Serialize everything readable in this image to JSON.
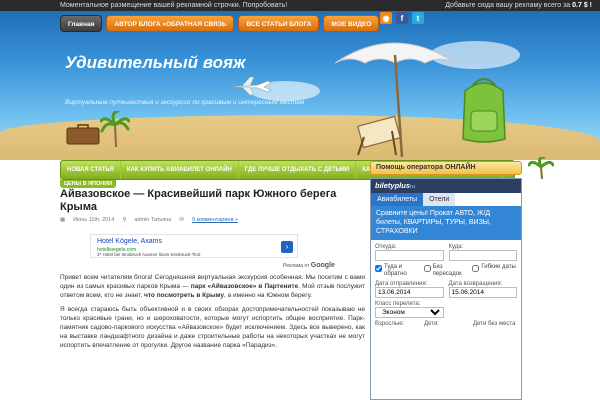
{
  "topbar": {
    "ticker": "Моментальное размещение вашей рекламной строчки. Попробовать!",
    "ad_text": "Добавьте сюда вашу рекламу всего за",
    "ad_price": "0.7 $ !"
  },
  "nav": {
    "items": [
      "Главная",
      "АВТОР БЛОГА «ОБРАТНАЯ СВЯЗЬ",
      "ВСЕ СТАТЬИ БЛОГА",
      "МОЕ ВИДЕО"
    ]
  },
  "header": {
    "title": "Удивительный вояж",
    "tagline": "Виртуальные путешествия и экскурсии по красивым и интересным местам"
  },
  "subnav": {
    "items": [
      "НОВАЯ СТАТЬЯ",
      "КАК КУПИТЬ АВИАБИЛЕТ ОНЛАЙН",
      "ГДЕ ЛУЧШЕ ОТДЫХАТЬ С ДЕТЬМИ",
      "КАК ПУТЕШЕСТВОВАТЬ САМОСТОЯТЕЛЬНО"
    ],
    "extra": "ЦЕНЫ В ЯПОНИИ"
  },
  "post": {
    "title": "Айвазовское — Красивейший парк Южного берега Крыма",
    "date": "Июнь 11th, 2014",
    "author": "admin Татьяна",
    "comments": "9 комментариев »"
  },
  "ad": {
    "title": "Hotel Kögele, Axams",
    "url": "hotelkoegele.com",
    "desc": "3* Hotel bei Innsbruck Axamer lizum-Innsbruck-Tirol",
    "label": "Реклама от",
    "brand": "Google"
  },
  "body": {
    "p1_a": "Привет всем читателям блога! Сегодняшняя виртуальная экскурсия особенная. Мы посетим с вами один из самых красивых парков Крыма — ",
    "p1_b": "парк «Айвазовское» в Партените",
    "p1_c": ". Мой отзыв послужит ответом всем, кто не знает, ",
    "p1_d": "что посмотреть в Крыму",
    "p1_e": ", а именно на Южном берегу.",
    "p2": "Я всегда стараюсь быть объективной и в своих обзорах достопримечательностей показываю не только красивые грани, но и шероховатости, которые могут испортить общее восприятие. Парк-памятник садово-паркового искусства «Айвазовское» будет исключением. Здесь все выверено, как на выставке ландшафтного дизайна и даже строительные работы на некоторых участках не могут испортить впечатление от прогулки. Другое название парка «Парадиз»."
  },
  "sidebar": {
    "help_title": "Помощь оператора ОНЛАЙН",
    "brand": "biletyplus",
    "brand_suffix": "ru",
    "tabs": [
      "Авиабилеты",
      "Отели"
    ],
    "promo": "Сравните цены! Прокат АВТО, Ж/Д билеты, КВАРТИРЫ, ТУРЫ, ВИЗЫ, СТРАХОВКИ",
    "from_label": "Откуда:",
    "to_label": "Куда:",
    "checks": [
      "Туда и обратно",
      "Без пересадок",
      "Гибкие даты"
    ],
    "depart_label": "Дата отправления:",
    "return_label": "Дата возвращения:",
    "depart_value": "13.06.2014",
    "return_value": "15.06.2014",
    "class_label": "Класс перелета:",
    "class_value": "Эконом",
    "pax_label": "Взрослые:",
    "kids_label": "Дети:",
    "infant_label": "Дети без места"
  },
  "colors": {
    "nav_orange": "#e48620",
    "subnav_green": "#8cbb2a",
    "brand_blue": "#2b75c8"
  }
}
